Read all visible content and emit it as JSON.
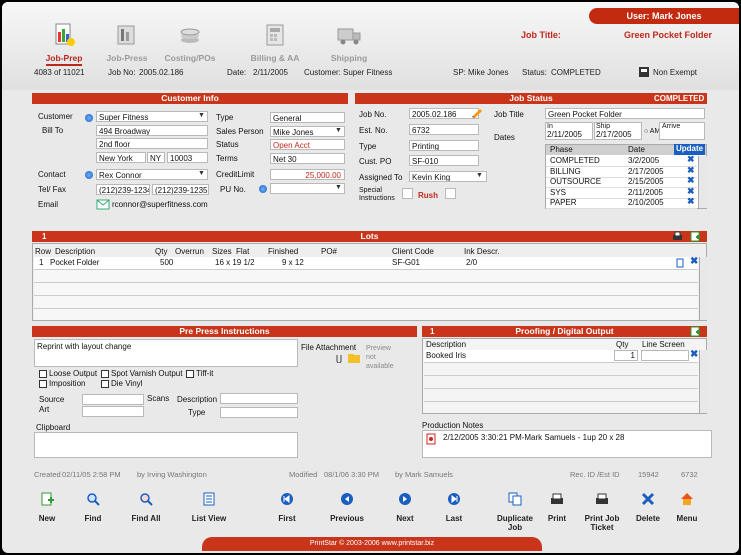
{
  "user": {
    "label": "User: Mark Jones"
  },
  "toolbar": {
    "items": [
      {
        "label": "Job-Prep",
        "icon": "job-prep-icon"
      },
      {
        "label": "Job-Press",
        "icon": "job-press-icon"
      },
      {
        "label": "Costing/POs",
        "icon": "costing-icon"
      },
      {
        "label": "Billing & AA",
        "icon": "billing-icon"
      },
      {
        "label": "Shipping",
        "icon": "shipping-icon"
      }
    ]
  },
  "job_title": {
    "label": "Job Title:",
    "value": "Green Pocket Folder"
  },
  "summary": {
    "record": "4083 of 11021",
    "job_no_label": "Job No:",
    "job_no": "2005.02.186",
    "date_label": "Date:",
    "date": "2/11/2005",
    "customer_label": "Customer:",
    "customer": "Super Fitness",
    "sp_label": "SP:",
    "sp": "Mike Jones",
    "status_label": "Status:",
    "status": "COMPLETED",
    "exempt": "Non Exempt"
  },
  "customer_info": {
    "title": "Customer Info",
    "customer_label": "Customer",
    "customer": "Super Fitness",
    "bill_to_label": "Bill To",
    "addr1": "494 Broadway",
    "addr2": "2nd floor",
    "city": "New York",
    "state": "NY",
    "zip": "10003",
    "contact_label": "Contact",
    "contact": "Rex Connor",
    "tel_label": "Tel/ Fax",
    "tel": "(212)239-1234",
    "fax": "(212)239-1235",
    "email_label": "Email",
    "email": "rconnor@superfitness.com",
    "type_label": "Type",
    "type": "General",
    "sales_label": "Sales Person",
    "sales": "Mike Jones",
    "status_label": "Status",
    "status": "Open Acct",
    "terms_label": "Terms",
    "terms": "Net 30",
    "credit_label": "CreditLimit",
    "credit": "25,000.00",
    "pu_label": "PU No."
  },
  "job_status": {
    "title": "Job Status",
    "badge": "COMPLETED",
    "job_no_label": "Job No.",
    "job_no": "2005.02.186",
    "est_label": "Est. No.",
    "est": "6732",
    "type_label": "Type",
    "type": "Printing",
    "cust_po_label": "Cust. PO",
    "cust_po": "SF-010",
    "assigned_label": "Assigned To",
    "assigned": "Kevin King",
    "special_label": "Special Instructions",
    "rush": "Rush",
    "job_title_label": "Job Title",
    "job_title": "Green Pocket Folder",
    "dates_label": "Dates",
    "in_label": "In",
    "in_date": "2/11/2005",
    "ship_label": "Ship",
    "ship_date": "2/17/2005",
    "am_label": "AM",
    "arrive_label": "Arrive",
    "phase_hdr": "Phase",
    "date_hdr": "Date",
    "update_btn": "Update",
    "phases": [
      {
        "phase": "COMPLETED",
        "date": "3/2/2005"
      },
      {
        "phase": "BILLING",
        "date": "2/17/2005"
      },
      {
        "phase": "OUTSOURCE",
        "date": "2/15/2005"
      },
      {
        "phase": "SYS",
        "date": "2/11/2005"
      },
      {
        "phase": "PAPER",
        "date": "2/10/2005"
      }
    ]
  },
  "lots": {
    "count": "1",
    "title": "Lots",
    "headers": {
      "row": "Row",
      "desc": "Description",
      "qty": "Qty",
      "overrun": "Overrun",
      "sizes": "Sizes",
      "flat": "Flat",
      "finished": "Finished",
      "po": "PO#",
      "client": "Client Code",
      "ink": "Ink Descr."
    },
    "rows": [
      {
        "row": "1",
        "desc": "Pocket Folder",
        "qty": "500",
        "overrun": "",
        "flat": "16 x 19 1/2",
        "finished": "9 x 12",
        "po": "",
        "client": "SF-G01",
        "ink": "2/0"
      }
    ]
  },
  "prepress": {
    "title": "Pre Press Instructions",
    "notes": "Reprint with layout change",
    "file_label": "File Attachment",
    "preview": "Preview not available",
    "checks": [
      "Loose Output",
      "Spot Varnish Output",
      "Tiff-it",
      "Imposition",
      "Die Vinyl"
    ],
    "source_label": "Source",
    "art_label": "Art",
    "scans_label": "Scans",
    "desc_label": "Description",
    "type_label": "Type",
    "clipboard_label": "Clipboard"
  },
  "proofing": {
    "count": "1",
    "title": "Proofing / Digital Output",
    "desc_hdr": "Description",
    "qty_hdr": "Qty",
    "line_hdr": "Line Screen",
    "rows": [
      {
        "desc": "Booked  Iris",
        "qty": "1",
        "line": ""
      }
    ]
  },
  "production_notes": {
    "label": "Production Notes",
    "note": "2/12/2005 3:30:21 PM-Mark Samuels  - 1up 20 x 28"
  },
  "audit": {
    "created_label": "Created",
    "created": "02/11/05   2:58 PM",
    "created_by": "by Irving Washington",
    "modified_label": "Modified",
    "modified": "08/1/06     3:30 PM",
    "modified_by": "by Mark Samuels",
    "rec_label": "Rec. ID /Est ID",
    "rec_id": "15942",
    "est_id": "6732"
  },
  "bottom": {
    "buttons": [
      {
        "label": "New"
      },
      {
        "label": "Find"
      },
      {
        "label": "Find All"
      },
      {
        "label": "List View"
      },
      {
        "label": "First"
      },
      {
        "label": "Previous"
      },
      {
        "label": "Next"
      },
      {
        "label": "Last"
      },
      {
        "label": "Duplicate Job"
      },
      {
        "label": "Print"
      },
      {
        "label": "Print Job Ticket"
      },
      {
        "label": "Delete"
      },
      {
        "label": "Menu"
      }
    ]
  },
  "footer": {
    "text": "PrintStar © 2003-2006 www.printstar.biz"
  }
}
